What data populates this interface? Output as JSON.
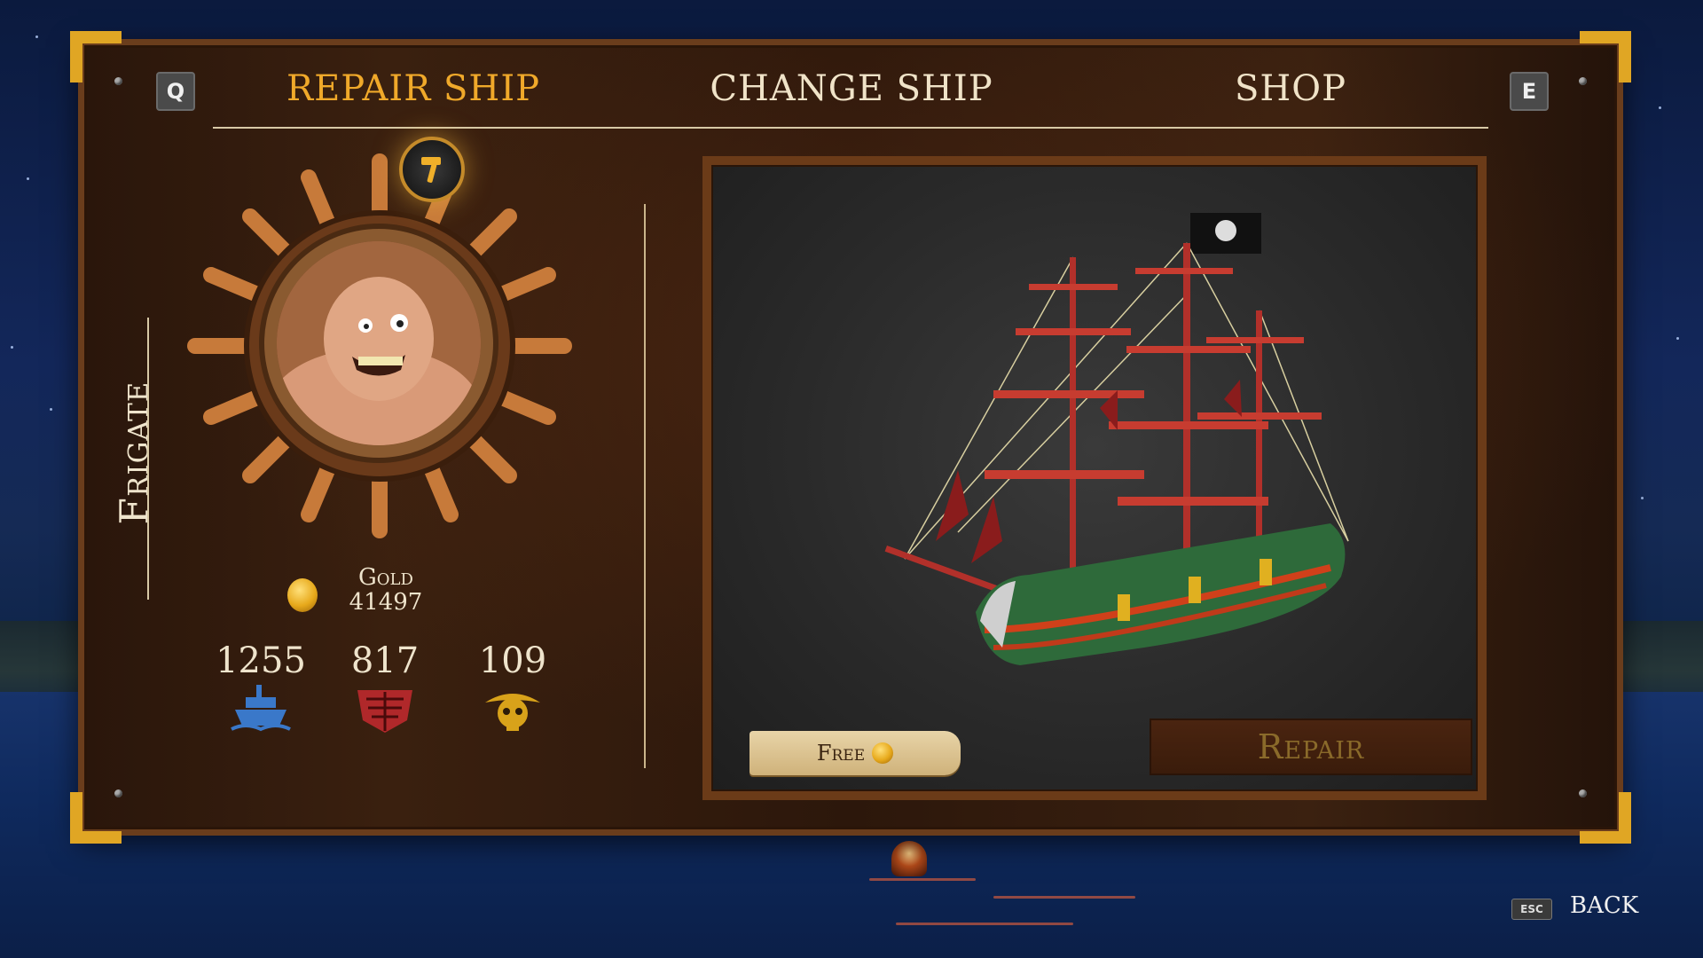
{
  "tabs": {
    "prev_key": "Q",
    "next_key": "E",
    "items": [
      {
        "label": "REPAIR SHIP",
        "active": true
      },
      {
        "label": "CHANGE SHIP",
        "active": false
      },
      {
        "label": "SHOP",
        "active": false
      }
    ]
  },
  "ship": {
    "class": "Frigate"
  },
  "resources": {
    "gold_label": "Gold",
    "gold_value": "41497",
    "stats": [
      {
        "value": "1255",
        "icon": "ship-hull-icon",
        "color": "#3a78c9"
      },
      {
        "value": "817",
        "icon": "armor-plate-icon",
        "color": "#b0282a"
      },
      {
        "value": "109",
        "icon": "skull-crew-icon",
        "color": "#d8a21a"
      }
    ]
  },
  "repair": {
    "cost_label": "Free",
    "button_label": "Repair"
  },
  "footer": {
    "esc_key": "ESC",
    "back_label": "BACK"
  },
  "colors": {
    "active_tab": "#f0a92a",
    "frame_gold": "#e0a624",
    "text_cream": "#efe4cc"
  }
}
